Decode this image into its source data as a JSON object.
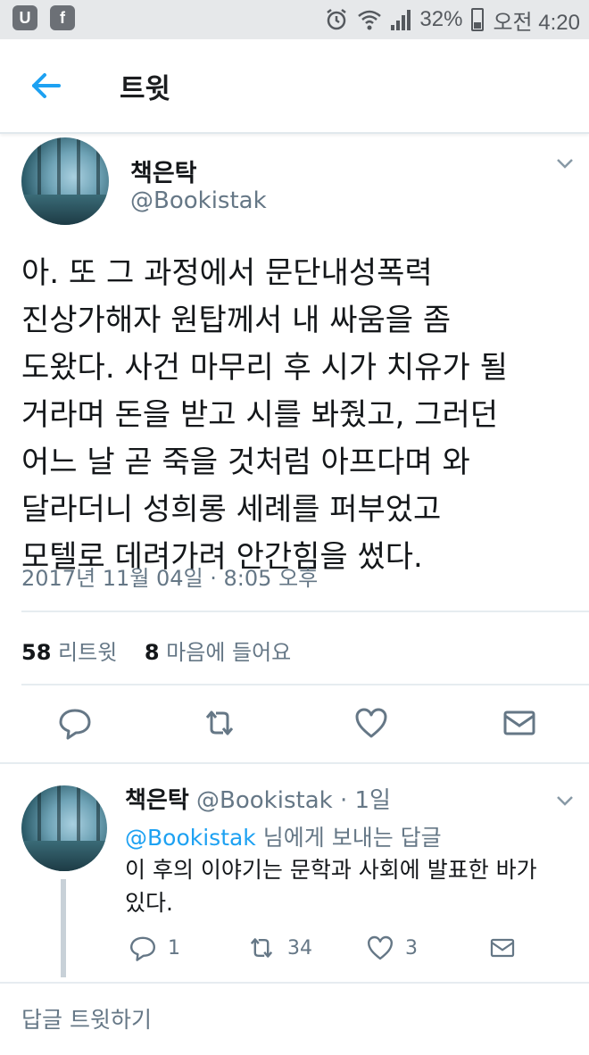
{
  "status_bar": {
    "app_icons": [
      "U",
      "f"
    ],
    "battery_percent": "32%",
    "time": "오전 4:20"
  },
  "header": {
    "back_icon": "back-arrow-icon",
    "title": "트윗"
  },
  "tweet": {
    "display_name": "책은탁",
    "handle": "@Bookistak",
    "lines": [
      "아. 또 그 과정에서 문단내성폭력",
      "진상가해자 원탑께서 내 싸움을 좀",
      "도왔다. 사건 마무리 후 시가 치유가 될",
      "거라며 돈을 받고 시를 봐줬고, 그러던",
      "어느 날 곧 죽을 것처럼 아프다며 와",
      "달라더니 성희롱 세례를 퍼부었고",
      "모텔로 데려가려 안간힘을 썼다."
    ],
    "timestamp": "2017년 11월 04일 · 8:05 오후",
    "retweet_count": "58",
    "retweet_label": "리트윗",
    "like_count": "8",
    "like_label": "마음에 들어요",
    "action_icons": [
      "reply-icon",
      "retweet-icon",
      "like-icon",
      "message-icon"
    ]
  },
  "reply": {
    "display_name": "책은탁",
    "meta": "@Bookistak · 1일",
    "mention": "@Bookistak",
    "reply_to_suffix": " 님에게 보내는 답글",
    "lines": [
      "이 후의 이야기는 문학과 사회에 발표한 바가",
      "있다."
    ],
    "reply_count": "1",
    "retweet_count": "34",
    "like_count": "3"
  },
  "compose_label": "답글 트윗하기",
  "colors": {
    "accent": "#1da1f2",
    "secondary_text": "#657786",
    "status_bar_bg": "#e6e8ea"
  }
}
